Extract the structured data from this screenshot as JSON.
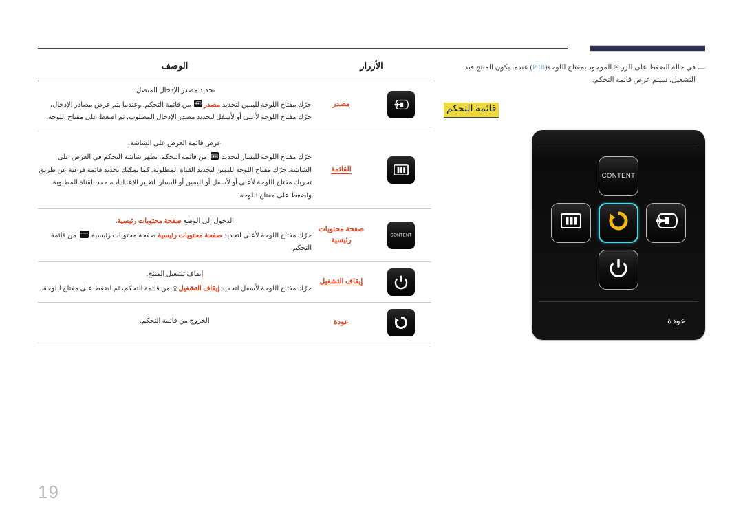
{
  "page": {
    "number": "19"
  },
  "note": {
    "dash": "—",
    "text_before_ref": "في حالة الضغط على الزر",
    "power_glyph": "◎",
    "text_mid": "الموجود بمفتاح اللوحة",
    "ref_open": "(",
    "ref": "P.18",
    "ref_close": ")",
    "text_after": "عندما يكون المنتج قيد التشغيل، سيتم عرض قائمة التحكم."
  },
  "section": {
    "title": "قائمة التحكم"
  },
  "device": {
    "keys": {
      "content": "CONTENT",
      "menu_icon": "menu-bars-icon",
      "return_icon": "return-arrow-icon",
      "source_icon": "source-input-icon",
      "power_icon": "power-icon"
    },
    "footer_label": "عودة"
  },
  "colors": {
    "accent_red": "#d9411e",
    "highlight_yellow": "#ecd93d",
    "rule_navy": "#3c3c5c",
    "selected_cyan": "#4fd8e8",
    "return_amber": "#f5b719"
  },
  "table": {
    "headers": {
      "buttons": "الأزرار",
      "description": "الوصف"
    },
    "rows": [
      {
        "icon": "source-input-icon",
        "name": "مصدر",
        "name_underlined": false,
        "lead": "تحديد مصدر الإدخال المتصل.",
        "body_parts": [
          {
            "type": "text",
            "value": "حرّك مفتاح اللوحة لليمين لتحديد "
          },
          {
            "type": "red",
            "value": "مصدر"
          },
          {
            "type": "glyph",
            "value": "source-input-icon"
          },
          {
            "type": "text",
            "value": " من قائمة التحكم. وعندما يتم عرض مصادر الإدخال، حرّك مفتاح اللوحة لأعلى أو لأسفل لتحديد مصدر الإدخال المطلوب، ثم اضغط على مفتاح اللوحة."
          }
        ]
      },
      {
        "icon": "menu-bars-icon",
        "name": "القائمة",
        "name_underlined": true,
        "lead": "عرض قائمة العرض على الشاشة.",
        "body_parts": [
          {
            "type": "text",
            "value": "حرّك مفتاح اللوحة لليسار لتحديد "
          },
          {
            "type": "glyph",
            "value": "menu-bars-icon"
          },
          {
            "type": "text",
            "value": " من قائمة التحكم. تظهر شاشة التحكم في العرض على الشاشة. حرّك مفتاح اللوحة لليمين لتحديد القناة المطلوبة. كما يمكنك تحديد قائمة فرعية عن طريق تحريك مفتاح اللوحة لأعلى أو لأسفل أو لليمين أو لليسار. لتغيير الإعدادات، حدد القناة المطلوبة واضغط على مفتاح اللوحة."
          }
        ]
      },
      {
        "icon": "content-icon",
        "name": "صفحة محتويات رئيسية",
        "name_underlined": false,
        "lead_parts": [
          {
            "type": "text",
            "value": "الدخول إلى الوضع "
          },
          {
            "type": "red",
            "value": "صفحة محتويات رئيسية"
          },
          {
            "type": "text",
            "value": "."
          }
        ],
        "body_parts": [
          {
            "type": "text",
            "value": "حرّك مفتاح اللوحة لأعلى لتحديد "
          },
          {
            "type": "red",
            "value": "صفحة محتويات رئيسية"
          },
          {
            "type": "text",
            "value": " صفحة محتويات رئيسية "
          },
          {
            "type": "glyph",
            "value": "content-icon"
          },
          {
            "type": "text",
            "value": " من قائمة التحكم."
          }
        ]
      },
      {
        "icon": "power-icon",
        "name": "إيقاف التشغيل",
        "name_underlined": true,
        "lead": "إيقاف تشغيل المنتج.",
        "body_parts": [
          {
            "type": "text",
            "value": "حرّك مفتاح اللوحة لأسفل لتحديد "
          },
          {
            "type": "red",
            "value": "إيقاف التشغيل"
          },
          {
            "type": "circ",
            "value": "◎"
          },
          {
            "type": "text",
            "value": " من قائمة التحكم، ثم اضغط على مفتاح اللوحة."
          }
        ]
      },
      {
        "icon": "return-arrow-icon",
        "name": "عودة",
        "name_underlined": false,
        "lead": "الخروج من قائمة التحكم.",
        "body_parts": []
      }
    ]
  }
}
